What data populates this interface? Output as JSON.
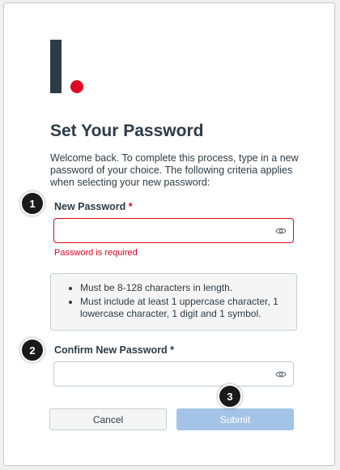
{
  "form": {
    "title": "Set Your Password",
    "intro": "Welcome back. To complete this process, type in a new password of your choice. The following criteria applies when selecting your new password:",
    "new_password_label": "New Password",
    "new_password_required_marker": "*",
    "new_password_value": "",
    "new_password_error": "Password is required",
    "confirm_password_label": "Confirm New Password",
    "confirm_password_required_marker": "*",
    "confirm_password_value": "",
    "criteria": [
      "Must be 8-128 characters in length.",
      "Must include at least 1 uppercase character, 1 lowercase character, 1 digit and 1 symbol."
    ],
    "cancel_label": "Cancel",
    "submit_label": "Submit"
  },
  "annotations": {
    "step1": "1",
    "step2": "2",
    "step3": "3"
  },
  "icons": {
    "logo": "canvas-logo",
    "new_password_toggle": "eye-icon",
    "confirm_password_toggle": "eye-icon"
  },
  "colors": {
    "brand_text": "#2d3b45",
    "brand_red": "#e0061f",
    "error": "#e0061f",
    "submit_disabled": "#a3c4e6",
    "badge": "#1a1a1a"
  }
}
